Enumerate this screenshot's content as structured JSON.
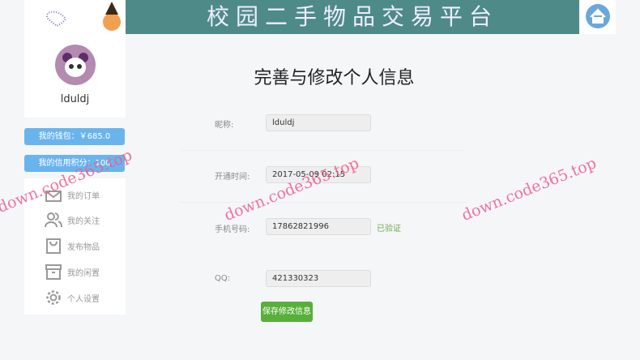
{
  "header": {
    "title": "校园二手物品交易平台",
    "home_icon": "home-icon"
  },
  "user": {
    "name": "lduldj",
    "wallet": "我的钱包：￥685.0",
    "credit": "我的信用积分：100"
  },
  "menu": [
    {
      "label": "我的订单",
      "icon": "envelope-icon"
    },
    {
      "label": "我的关注",
      "icon": "users-icon"
    },
    {
      "label": "发布物品",
      "icon": "bag-icon"
    },
    {
      "label": "我的闲置",
      "icon": "archive-icon"
    },
    {
      "label": "个人设置",
      "icon": "gear-icon"
    }
  ],
  "form": {
    "title": "完善与修改个人信息",
    "nickname_label": "昵称:",
    "nickname": "lduldj",
    "opened_label": "开通时间:",
    "opened": "2017-05-09 02:15",
    "phone_label": "手机号码:",
    "phone": "17862821996",
    "phone_status": "已验证",
    "qq_label": "QQ:",
    "qq": "421330323",
    "save": "保存修改信息"
  },
  "watermark": "down.code365.top",
  "colors": {
    "banner": "#4e8a88",
    "blue": "#6ab4ee",
    "green": "#58b03a"
  }
}
